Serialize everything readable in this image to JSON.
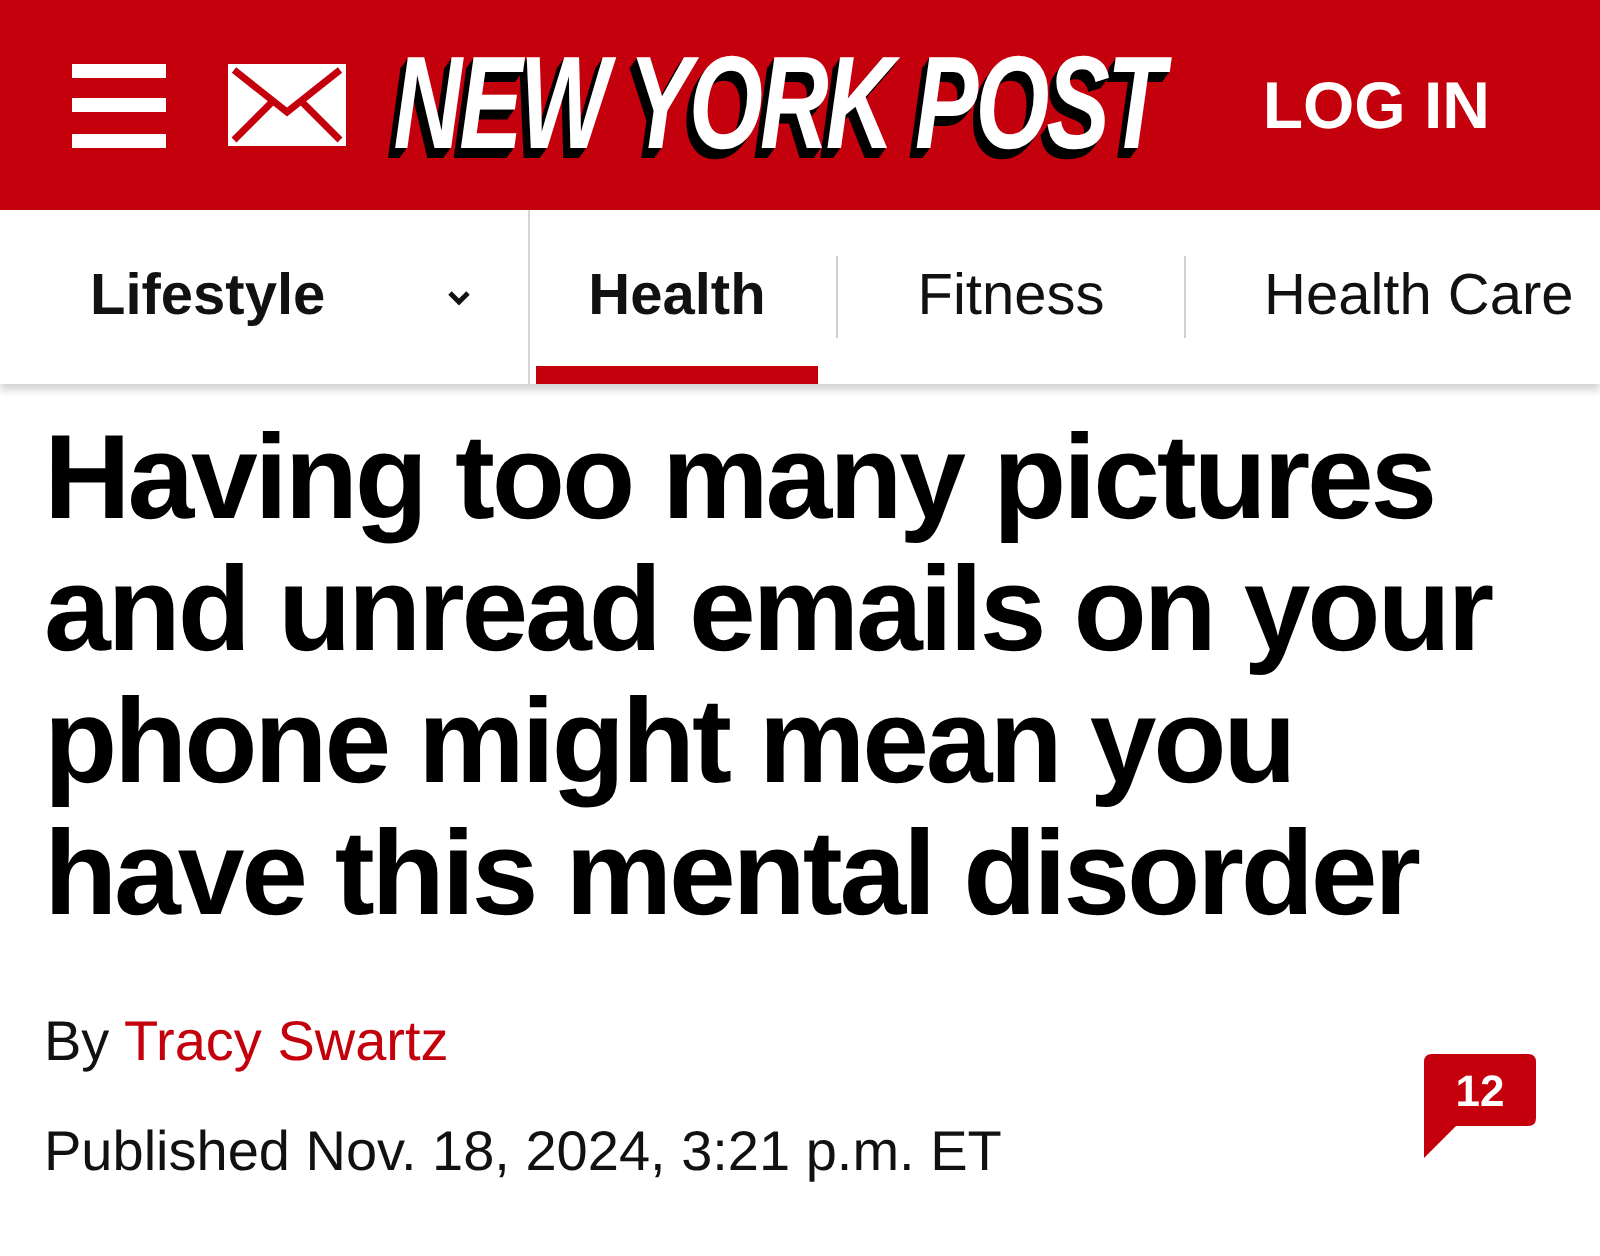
{
  "header": {
    "logo": "NEW YORK POST",
    "login": "LOG IN"
  },
  "nav": {
    "section": "Lifestyle",
    "tabs": [
      {
        "label": "Health",
        "selected": true
      },
      {
        "label": "Fitness",
        "selected": false
      },
      {
        "label": "Health Care",
        "selected": false
      }
    ]
  },
  "article": {
    "headline": "Having too many pictures and unread emails on your phone might mean you have this mental disorder",
    "byline": {
      "prefix": "By",
      "author": "Tracy Swartz"
    },
    "published": "Published Nov. 18, 2024, 3:21 p.m. ET",
    "comment_count": "12"
  }
}
